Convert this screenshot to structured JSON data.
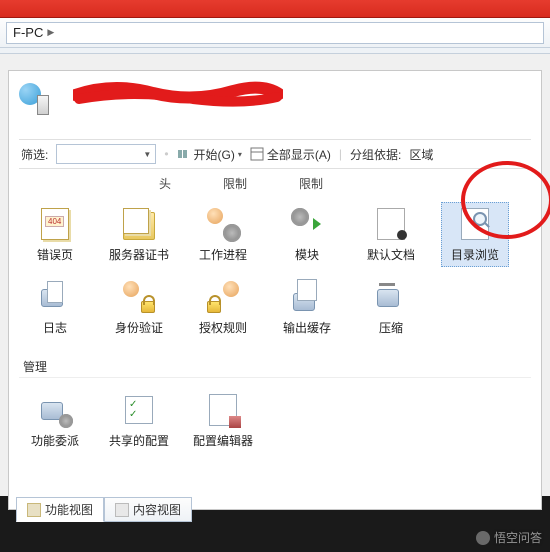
{
  "breadcrumb": {
    "node": "F-PC",
    "arrow": "▶"
  },
  "toolbar": {
    "filter_label": "筛选:",
    "start_label": "开始(G)",
    "showall_label": "全部显示(A)",
    "groupby_label": "分组依据:",
    "groupby_value": "区域"
  },
  "column_headers": {
    "h1": "头",
    "h2": "限制",
    "h3": "限制"
  },
  "icons_row1": [
    {
      "label": "错误页",
      "name": "error-pages-item"
    },
    {
      "label": "服务器证书",
      "name": "server-certificates-item"
    },
    {
      "label": "工作进程",
      "name": "worker-processes-item"
    },
    {
      "label": "模块",
      "name": "modules-item"
    },
    {
      "label": "默认文档",
      "name": "default-document-item"
    },
    {
      "label": "目录浏览",
      "name": "directory-browsing-item",
      "selected": true
    }
  ],
  "icons_row2": [
    {
      "label": "日志",
      "name": "logging-item"
    },
    {
      "label": "身份验证",
      "name": "authentication-item"
    },
    {
      "label": "授权规则",
      "name": "authorization-rules-item"
    },
    {
      "label": "输出缓存",
      "name": "output-caching-item"
    },
    {
      "label": "压缩",
      "name": "compression-item"
    }
  ],
  "group2_label": "管理",
  "icons_row3": [
    {
      "label": "功能委派",
      "name": "feature-delegation-item"
    },
    {
      "label": "共享的配置",
      "name": "shared-configuration-item"
    },
    {
      "label": "配置编辑器",
      "name": "configuration-editor-item"
    }
  ],
  "tabs": {
    "features": "功能视图",
    "content": "内容视图"
  },
  "watermark": "悟空问答"
}
